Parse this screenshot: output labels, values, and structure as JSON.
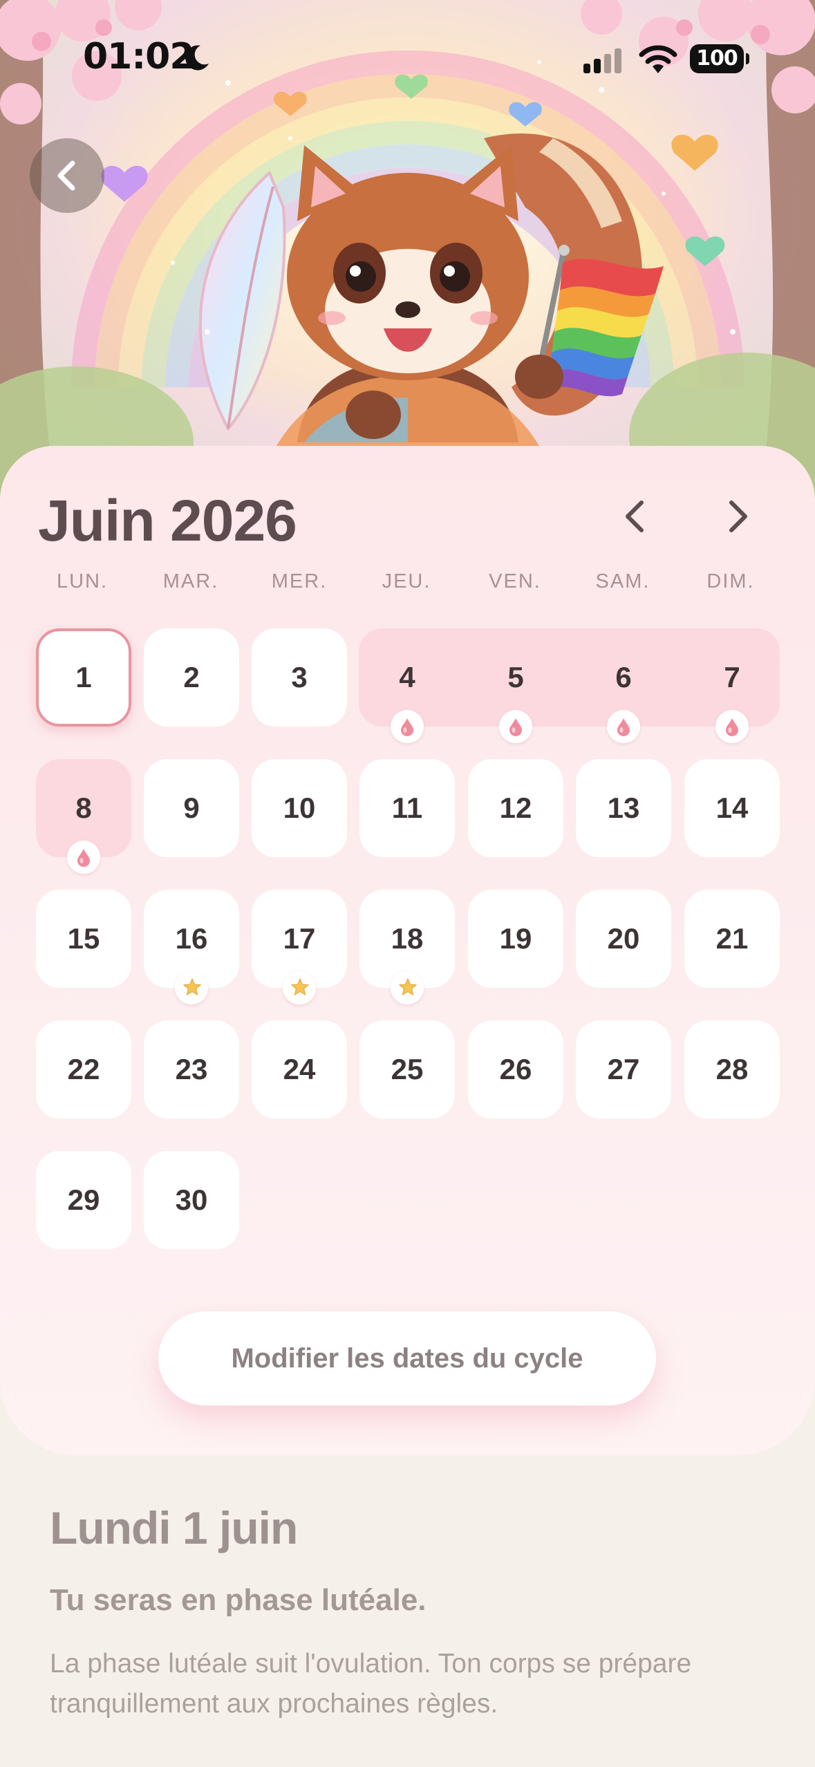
{
  "status_bar": {
    "time": "01:02",
    "battery": "100"
  },
  "calendar": {
    "month_title": "Juin 2026",
    "weekdays": [
      "LUN.",
      "MAR.",
      "MER.",
      "JEU.",
      "VEN.",
      "SAM.",
      "DIM."
    ],
    "days": [
      {
        "n": "1",
        "today": true
      },
      {
        "n": "2"
      },
      {
        "n": "3"
      },
      {
        "n": "4",
        "period": true,
        "marker": "drop-icon"
      },
      {
        "n": "5",
        "period": true,
        "marker": "drop-icon"
      },
      {
        "n": "6",
        "period": true,
        "marker": "drop-icon"
      },
      {
        "n": "7",
        "period": true,
        "marker": "drop-icon"
      },
      {
        "n": "8",
        "period": true,
        "marker": "drop-icon"
      },
      {
        "n": "9"
      },
      {
        "n": "10"
      },
      {
        "n": "11"
      },
      {
        "n": "12"
      },
      {
        "n": "13"
      },
      {
        "n": "14"
      },
      {
        "n": "15"
      },
      {
        "n": "16",
        "marker": "star-icon"
      },
      {
        "n": "17",
        "marker": "star-icon"
      },
      {
        "n": "18",
        "marker": "star-icon"
      },
      {
        "n": "19"
      },
      {
        "n": "20"
      },
      {
        "n": "21"
      },
      {
        "n": "22"
      },
      {
        "n": "23"
      },
      {
        "n": "24"
      },
      {
        "n": "25"
      },
      {
        "n": "26"
      },
      {
        "n": "27"
      },
      {
        "n": "28"
      },
      {
        "n": "29"
      },
      {
        "n": "30"
      }
    ],
    "edit_button_label": "Modifier les dates du cycle"
  },
  "detail": {
    "date": "Lundi 1 juin",
    "phase": "Tu seras en phase lutéale.",
    "description": "La phase lutéale suit l'ovulation. Ton corps se prépare tranquillement aux prochaines règles."
  },
  "colors": {
    "card_background": "#fde7ea",
    "period_highlight": "#fcd9df",
    "today_border": "#e8959f",
    "drop_marker": "#f08a9c",
    "star_marker": "#f6c453"
  }
}
